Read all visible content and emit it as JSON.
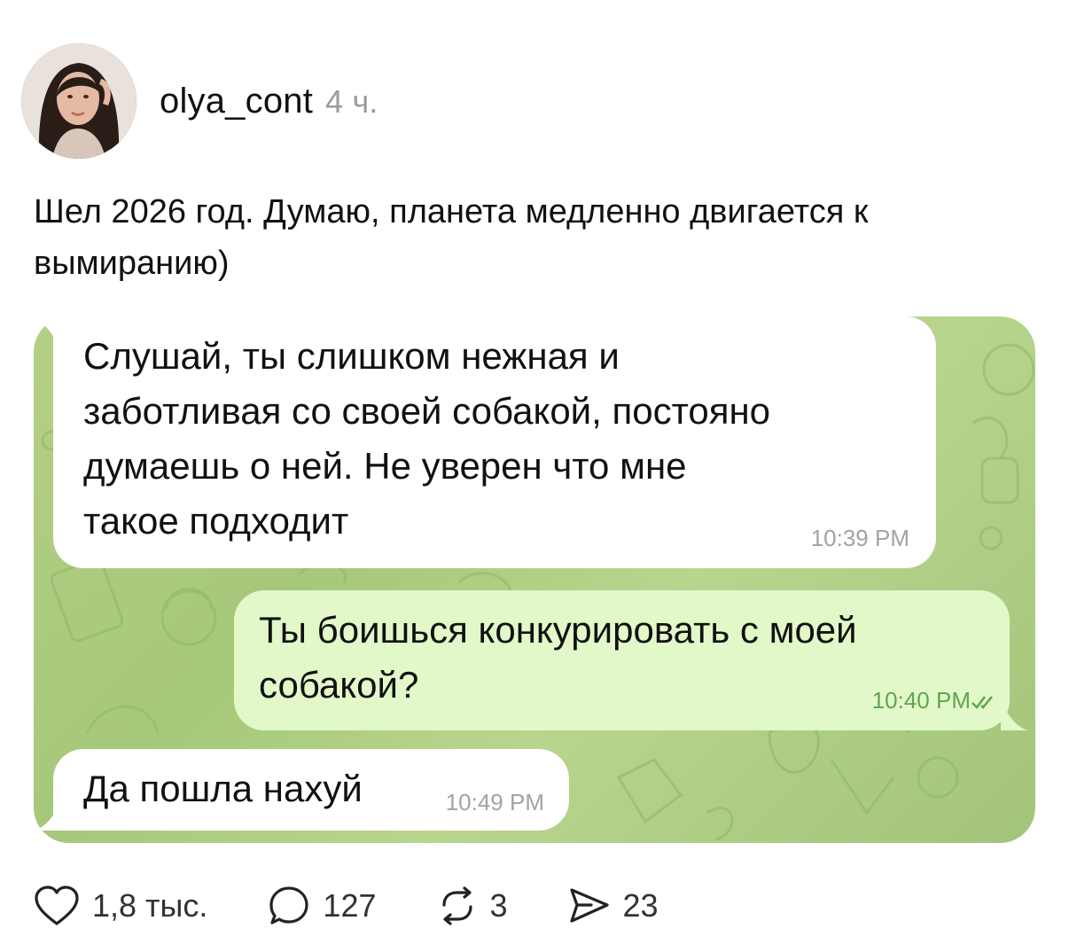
{
  "author": {
    "username": "olya_cont",
    "time": "4 ч."
  },
  "post": {
    "text": "Шел 2026 год. Думаю, планета медленно двигается к вымиранию)"
  },
  "chat": {
    "messages": [
      {
        "text": "Слушай, ты слишком нежная и\nзаботливая со своей собакой, постояно\nдумаешь о ней. Не уверен что мне\nтакое подходит",
        "time": "10:39 PM",
        "direction": "incoming"
      },
      {
        "text": "Ты боишься конкурировать с моей\nсобакой?",
        "time": "10:40 PM",
        "direction": "outgoing",
        "read_icon": "double-check-icon"
      },
      {
        "text": "Да пошла нахуй",
        "time": "10:49 PM",
        "direction": "incoming"
      }
    ],
    "colors": {
      "wallpaper": "#a9c97c",
      "incoming_bubble": "#ffffff",
      "outgoing_bubble": "#e3f8c9",
      "outgoing_meta": "#5fa64f"
    }
  },
  "actions": {
    "likes": "1,8 тыс.",
    "replies": "127",
    "reposts": "3",
    "shares": "23",
    "icons": [
      "heart-icon",
      "comment-icon",
      "repost-icon",
      "share-icon"
    ]
  }
}
